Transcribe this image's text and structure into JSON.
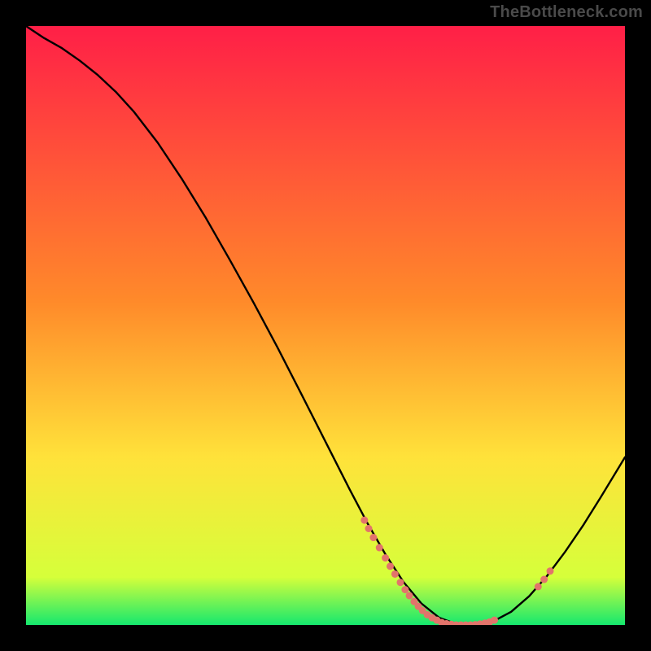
{
  "watermark": "TheBottleneck.com",
  "chart_data": {
    "type": "line",
    "title": "",
    "xlabel": "",
    "ylabel": "",
    "xlim": [
      0,
      100
    ],
    "ylim": [
      0,
      100
    ],
    "grid": false,
    "legend": false,
    "background_gradient": {
      "top_color": "#ff1f47",
      "mid_color": "#ffe23a",
      "bottom_color": "#15e86e"
    },
    "series": [
      {
        "name": "curve",
        "type": "line",
        "color": "#000000",
        "x": [
          0,
          3,
          6,
          9,
          12,
          15,
          18,
          22,
          26,
          30,
          34,
          38,
          42,
          46,
          50,
          54,
          57,
          60,
          63,
          66,
          69,
          72,
          75,
          78,
          81,
          84,
          87,
          90,
          93,
          96,
          100
        ],
        "y": [
          100,
          98,
          96.3,
          94.2,
          91.8,
          89,
          85.7,
          80.5,
          74.5,
          68,
          61,
          53.8,
          46.3,
          38.5,
          30.6,
          22.7,
          17,
          11.8,
          7.2,
          3.6,
          1.2,
          0.1,
          0.0,
          0.6,
          2.2,
          4.8,
          8.2,
          12.2,
          16.6,
          21.4,
          28.0
        ]
      },
      {
        "name": "left-cluster-points",
        "type": "scatter",
        "color": "#e2746b",
        "marker_size": 9,
        "x": [
          56.5,
          57.2,
          58.0,
          59.0,
          60.0,
          60.8,
          61.6,
          62.5,
          63.3,
          64.0,
          64.8,
          65.5,
          66.2,
          67.0,
          67.8,
          68.6,
          69.4,
          70.2,
          71.0
        ],
        "y": [
          17.5,
          16.1,
          14.6,
          12.9,
          11.2,
          9.8,
          8.5,
          7.1,
          5.9,
          4.9,
          3.9,
          3.1,
          2.4,
          1.7,
          1.2,
          0.8,
          0.4,
          0.2,
          0.1
        ]
      },
      {
        "name": "bottom-points",
        "type": "scatter",
        "color": "#e2746b",
        "marker_size": 9,
        "x": [
          71.8,
          72.6,
          73.4,
          74.2,
          75.0,
          75.8,
          76.6,
          77.4,
          78.2
        ],
        "y": [
          0.0,
          0.0,
          0.0,
          0.0,
          0.05,
          0.15,
          0.3,
          0.5,
          0.8
        ]
      },
      {
        "name": "right-pair-points",
        "type": "scatter",
        "color": "#e2746b",
        "marker_size": 9,
        "x": [
          85.5,
          86.5,
          87.5
        ],
        "y": [
          6.4,
          7.6,
          9.0
        ]
      }
    ]
  }
}
